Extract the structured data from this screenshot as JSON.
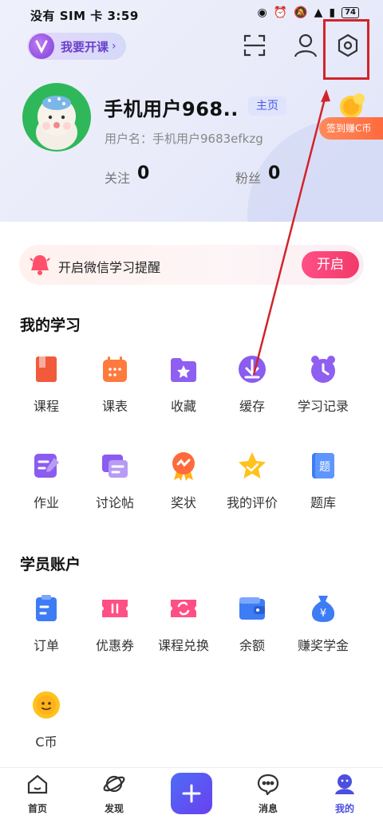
{
  "status_bar": {
    "left_text": "没有 SIM 卡 3:59",
    "battery": "74"
  },
  "header": {
    "course_label": "我要开课"
  },
  "profile": {
    "username": "手机用户968..",
    "home_badge": "主页",
    "user_id": "用户名：手机用户9683efkzg",
    "follow_label": "关注",
    "follow_count": "0",
    "fans_label": "粉丝",
    "fans_count": "0",
    "coin_promo": "签到赚C币"
  },
  "notify": {
    "text": "开启微信学习提醒",
    "button": "开启"
  },
  "my_study": {
    "title": "我的学习",
    "items": [
      {
        "label": "课程",
        "icon": "course-icon",
        "color": "#f25a3c"
      },
      {
        "label": "课表",
        "icon": "calendar-icon",
        "color": "#ff7a3d"
      },
      {
        "label": "收藏",
        "icon": "favorite-folder-icon",
        "color": "#8e5ff0"
      },
      {
        "label": "缓存",
        "icon": "download-icon",
        "color": "#8a5cf0"
      },
      {
        "label": "学习记录",
        "icon": "clock-icon",
        "color": "#8e5ff0"
      },
      {
        "label": "作业",
        "icon": "homework-icon",
        "color": "#8a5cf0"
      },
      {
        "label": "讨论帖",
        "icon": "discussion-icon",
        "color": "#8a5cf0"
      },
      {
        "label": "奖状",
        "icon": "award-icon",
        "color": "#ff6a3d"
      },
      {
        "label": "我的评价",
        "icon": "star-icon",
        "color": "#ffc21c"
      },
      {
        "label": "题库",
        "icon": "question-bank-icon",
        "color": "#3d7cf5"
      }
    ]
  },
  "account": {
    "title": "学员账户",
    "items": [
      {
        "label": "订单",
        "icon": "order-icon",
        "color": "#3d7cf5"
      },
      {
        "label": "优惠券",
        "icon": "coupon-icon",
        "color": "#ff4f84"
      },
      {
        "label": "课程兑换",
        "icon": "exchange-icon",
        "color": "#ff4f84"
      },
      {
        "label": "余额",
        "icon": "wallet-icon",
        "color": "#3d7cf5"
      },
      {
        "label": "赚奖学金",
        "icon": "money-bag-icon",
        "color": "#3d7cf5"
      },
      {
        "label": "C币",
        "icon": "coin-icon",
        "color": "#ffc21c"
      }
    ]
  },
  "tabbar": {
    "tabs": [
      {
        "label": "首页",
        "icon": "home-icon"
      },
      {
        "label": "发现",
        "icon": "planet-icon"
      },
      {
        "label": "消息",
        "icon": "message-icon"
      },
      {
        "label": "我的",
        "icon": "profile-icon"
      }
    ]
  }
}
